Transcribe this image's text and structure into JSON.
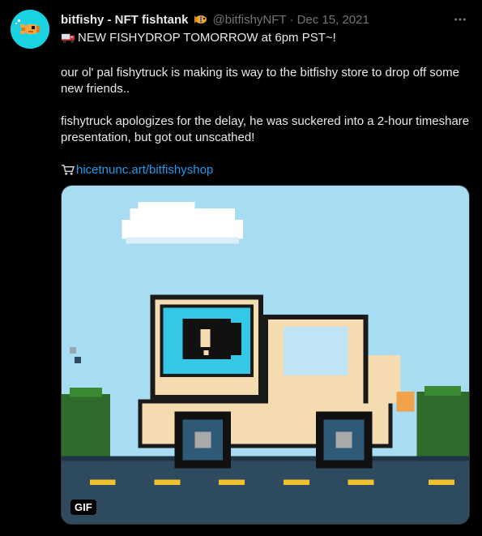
{
  "tweet": {
    "display_name": "bitfishy - NFT fishtank",
    "name_emoji": "tropical-fish-emoji",
    "handle": "@bitfishyNFT",
    "separator": "·",
    "date": "Dec 15, 2021",
    "more_icon": "more-icon",
    "lines": {
      "l1": "NEW FISHYDROP TOMORROW at 6pm PST~!",
      "l2": "our ol' pal fishytruck is making its way to the bitfishy store to drop off some new friends..",
      "l3": "fishytruck apologizes for the delay, he was suckered into a 2-hour timeshare presentation, but got out unscathed!",
      "link": "hicetnunc.art/bitfishyshop"
    },
    "icons": {
      "l1": "delivery-truck-icon",
      "link": "shopping-cart-icon"
    },
    "media": {
      "badge": "GIF"
    }
  }
}
